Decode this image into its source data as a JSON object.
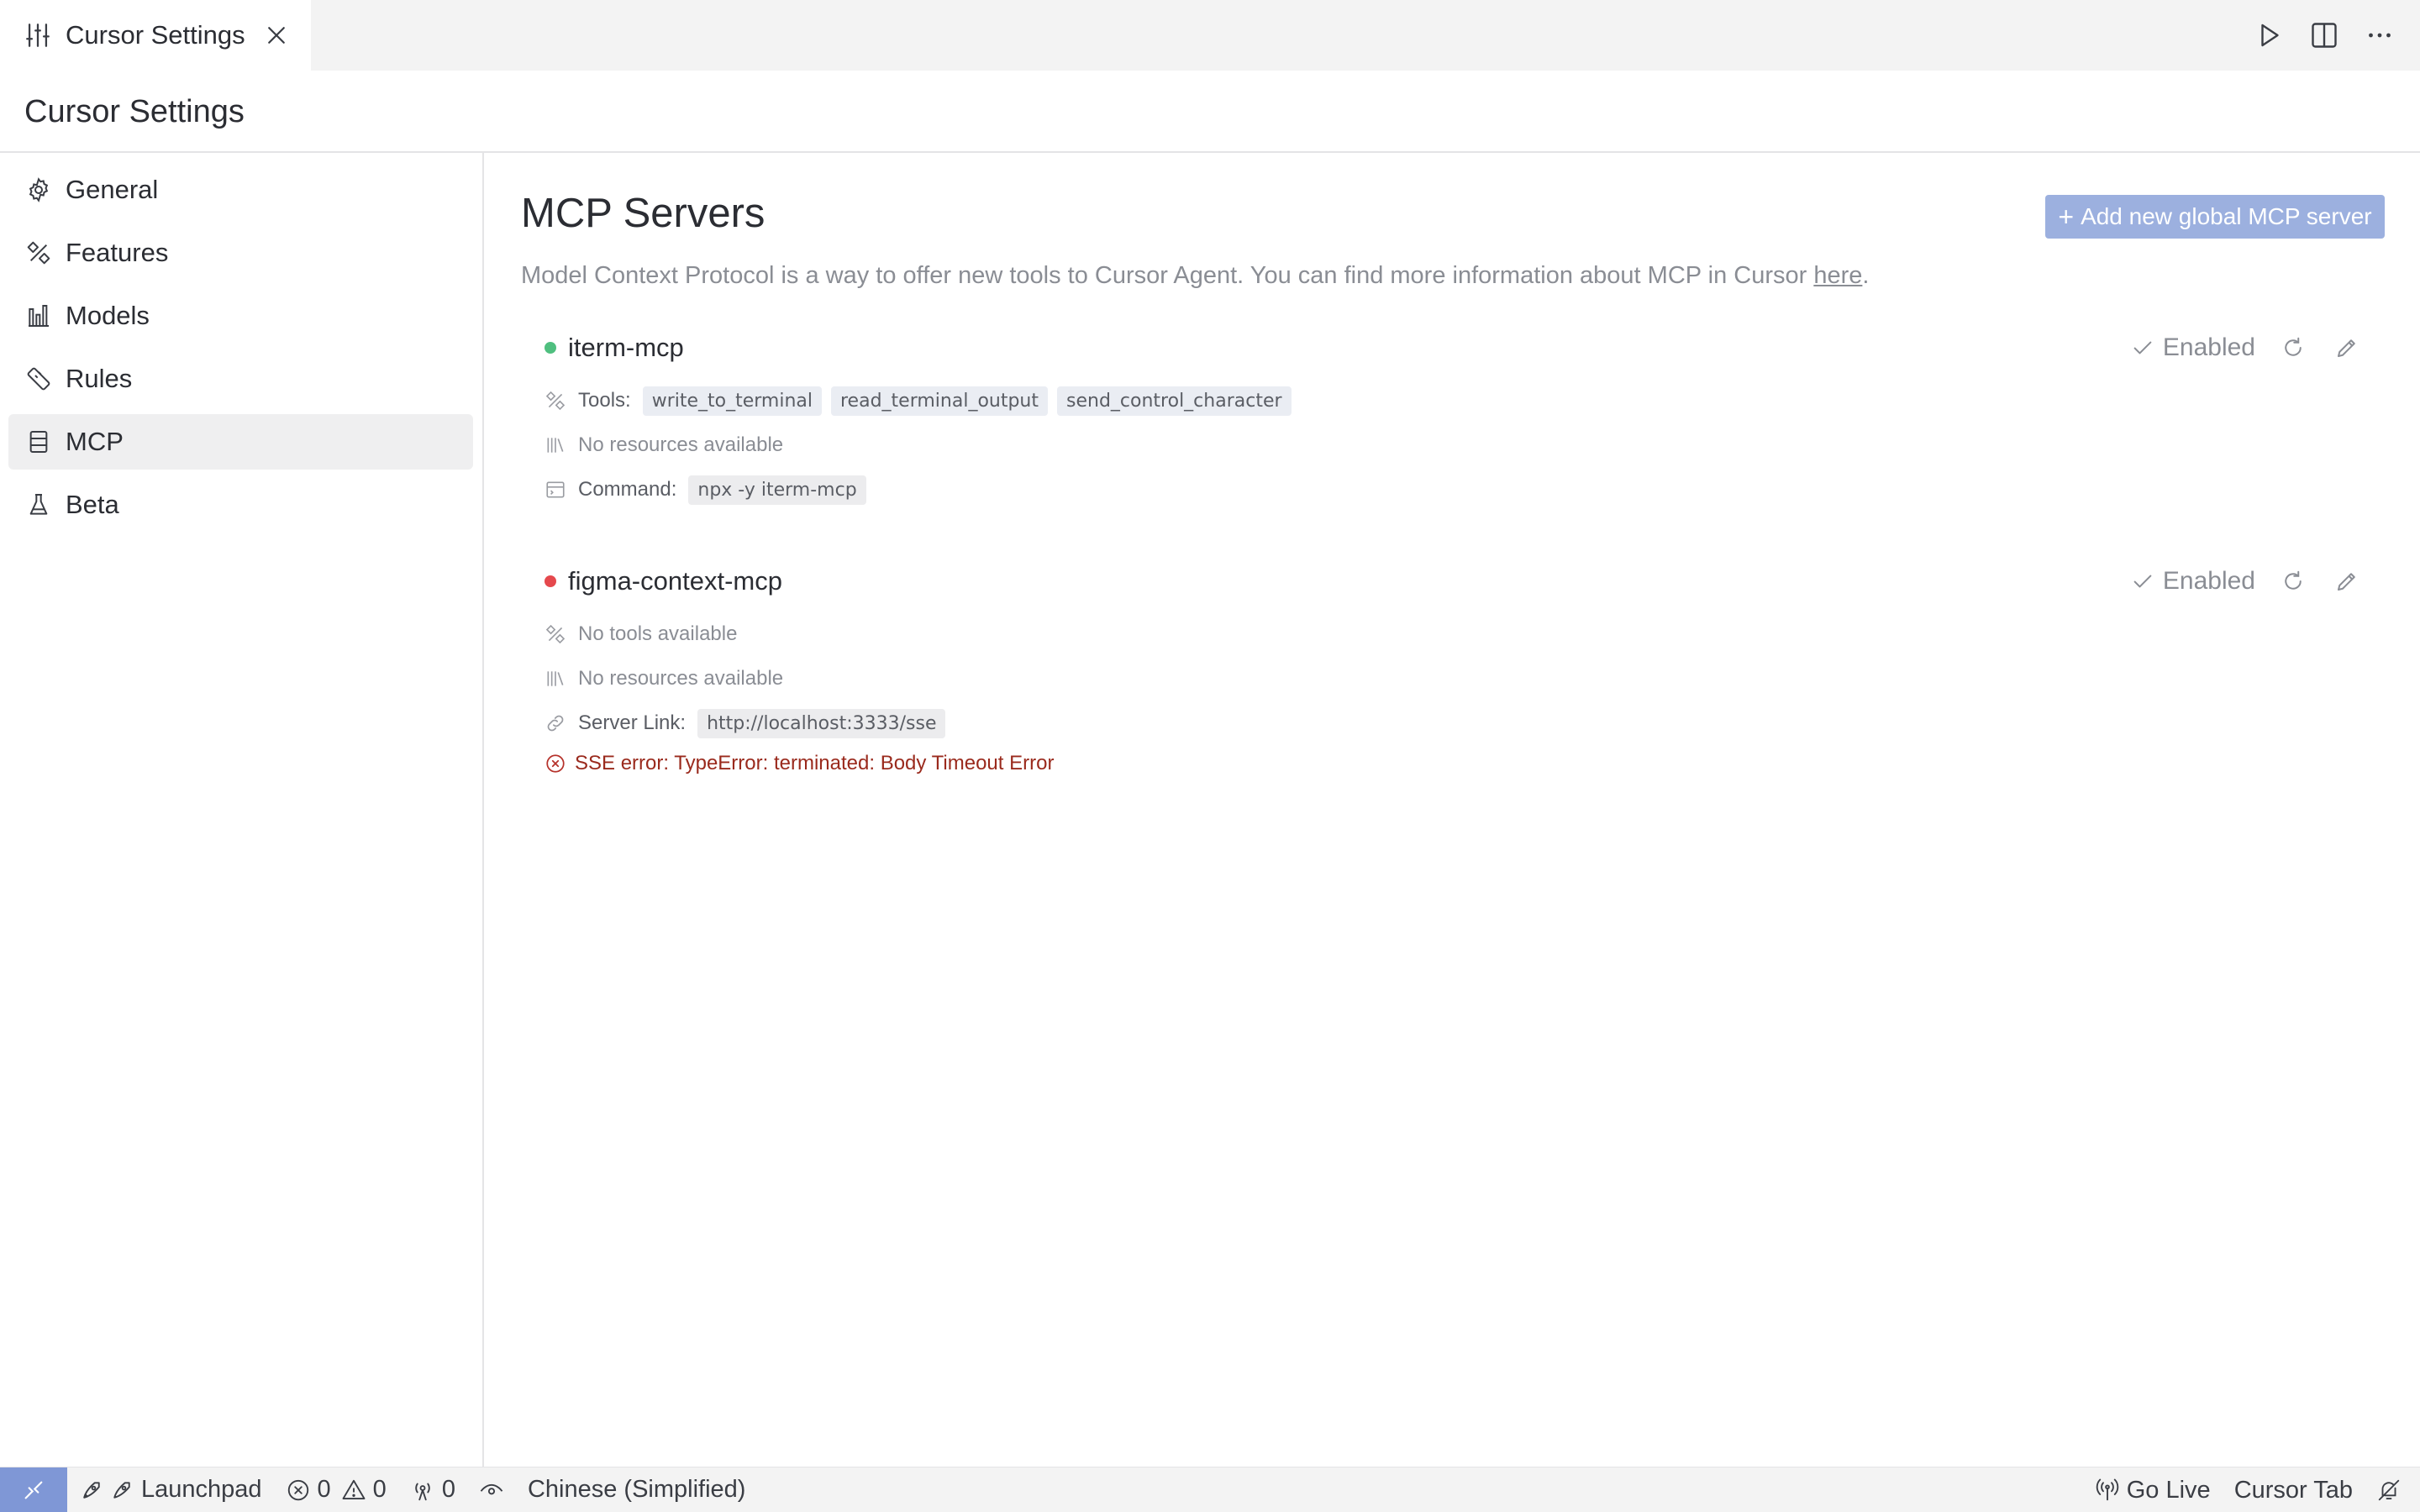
{
  "tab": {
    "title": "Cursor Settings",
    "icons": {
      "settings": "sliders-icon",
      "close": "close-icon"
    }
  },
  "editor_actions": [
    "run-icon",
    "split-editor-icon",
    "more-icon"
  ],
  "page": {
    "title": "Cursor Settings"
  },
  "sidebar": {
    "active": "MCP",
    "items": [
      {
        "label": "General",
        "icon": "gear-icon"
      },
      {
        "label": "Features",
        "icon": "features-icon"
      },
      {
        "label": "Models",
        "icon": "bar-chart-icon"
      },
      {
        "label": "Rules",
        "icon": "ruler-icon"
      },
      {
        "label": "MCP",
        "icon": "server-icon"
      },
      {
        "label": "Beta",
        "icon": "flask-icon"
      }
    ]
  },
  "main": {
    "title": "MCP Servers",
    "add_button": {
      "plus": "+",
      "label": "Add new global MCP server"
    },
    "description": {
      "text": "Model Context Protocol is a way to offer new tools to Cursor Agent. You can find more information about MCP in Cursor ",
      "link": "here",
      "suffix": "."
    },
    "servers": [
      {
        "name": "iterm-mcp",
        "status_color": "#4fbf7f",
        "enabled_label": "Enabled",
        "tools_label": "Tools:",
        "tools": [
          "write_to_terminal",
          "read_terminal_output",
          "send_control_character"
        ],
        "resources": "No resources available",
        "command_label": "Command:",
        "command": "npx -y iterm-mcp"
      },
      {
        "name": "figma-context-mcp",
        "status_color": "#e5484d",
        "enabled_label": "Enabled",
        "tools_text": "No tools available",
        "resources": "No resources available",
        "link_label": "Server Link:",
        "link": "http://localhost:3333/sse",
        "error": "SSE error: TypeError: terminated: Body Timeout Error"
      }
    ]
  },
  "statusbar": {
    "launchpad": "Launchpad",
    "errors": "0",
    "warnings": "0",
    "ports": "0",
    "language": "Chinese (Simplified)",
    "go_live": "Go Live",
    "cursor_tab": "Cursor Tab",
    "accent_color": "#7f97d6"
  }
}
